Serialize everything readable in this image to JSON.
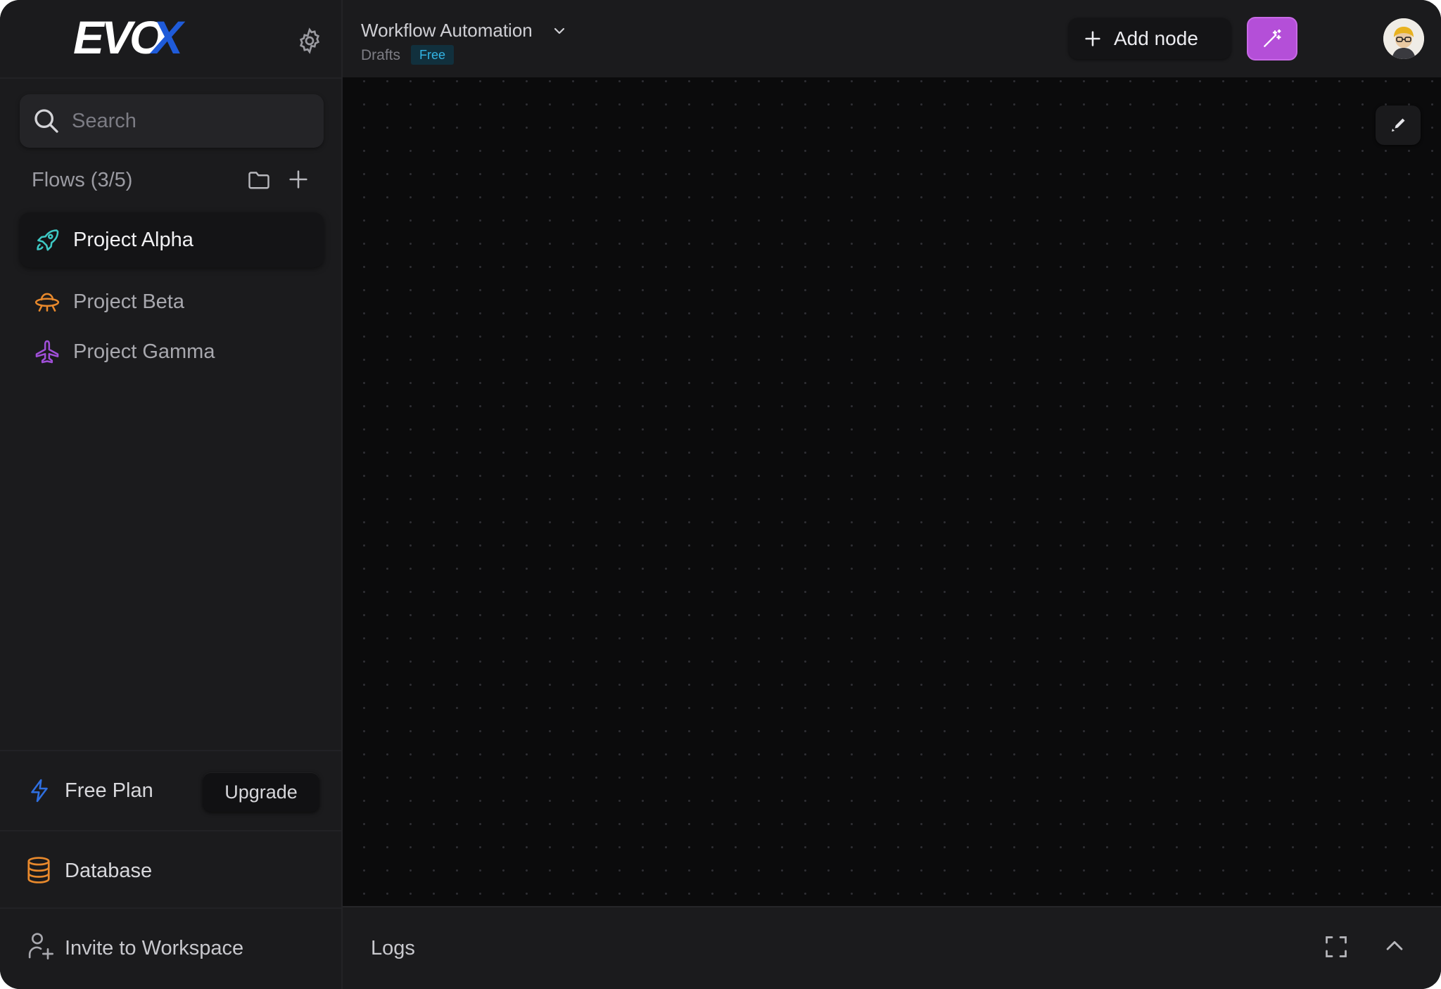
{
  "app": {
    "logo_text": "EVOX",
    "colors": {
      "accent_purple": "#b44fd8",
      "free_badge": "#33b5e5",
      "logo_blue": "#1f5bd9"
    }
  },
  "sidebar": {
    "search": {
      "placeholder": "Search"
    },
    "flows_label": "Flows (3/5)",
    "flows": [
      {
        "label": "Project Alpha",
        "icon": "rocket-icon",
        "color": "#3ec9c4",
        "active": true
      },
      {
        "label": "Project Beta",
        "icon": "ufo-icon",
        "color": "#e8892c",
        "active": false
      },
      {
        "label": "Project Gamma",
        "icon": "plane-icon",
        "color": "#a04fd8",
        "active": false
      }
    ],
    "plan": {
      "label": "Free Plan",
      "upgrade_label": "Upgrade"
    },
    "database_label": "Database",
    "invite_label": "Invite to Workspace"
  },
  "header": {
    "title": "Workflow Automation",
    "subtitle": "Drafts",
    "badge": "Free",
    "add_node_label": "Add node"
  },
  "logs": {
    "label": "Logs"
  }
}
